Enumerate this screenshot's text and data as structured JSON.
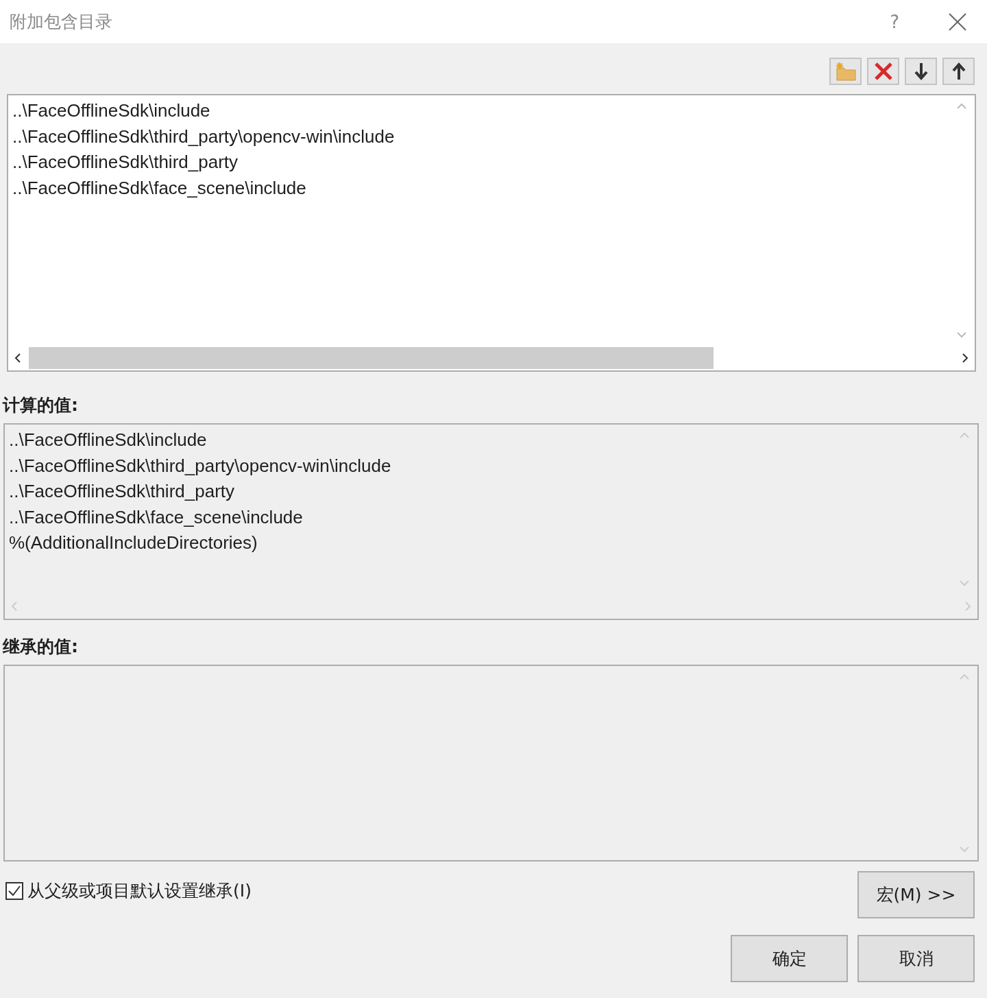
{
  "window": {
    "title": "附加包含目录",
    "help": "?"
  },
  "toolbar": [
    {
      "kind": "new-line"
    },
    {
      "kind": "delete"
    },
    {
      "kind": "move-down"
    },
    {
      "kind": "move-up"
    }
  ],
  "entries": [
    "..\\FaceOfflineSdk\\include",
    "..\\FaceOfflineSdk\\third_party\\opencv-win\\include",
    "..\\FaceOfflineSdk\\third_party",
    "..\\FaceOfflineSdk\\face_scene\\include"
  ],
  "computed": {
    "label": "计算的值:",
    "lines": [
      "..\\FaceOfflineSdk\\include",
      "..\\FaceOfflineSdk\\third_party\\opencv-win\\include",
      "..\\FaceOfflineSdk\\third_party",
      "..\\FaceOfflineSdk\\face_scene\\include",
      "%(AdditionalIncludeDirectories)"
    ]
  },
  "inherited": {
    "label": "继承的值:"
  },
  "inherit_checkbox": {
    "label": "从父级或项目默认设置继承(I)",
    "checked": true
  },
  "macros_button": "宏(M) >>",
  "buttons": [
    "确定",
    "取消"
  ]
}
